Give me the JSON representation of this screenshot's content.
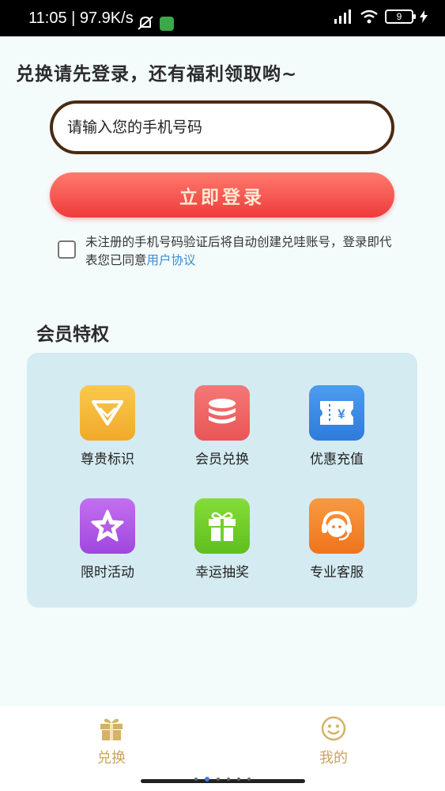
{
  "status_bar": {
    "time": "11:05 | 97.9K/s",
    "battery": "9"
  },
  "headline": "兑换请先登录，还有福利领取哟~",
  "login": {
    "phone_placeholder": "请输入您的手机号码",
    "button_label": "立即登录"
  },
  "agreement": {
    "text": "未注册的手机号码验证后将自动创建兑哇账号，登录即代表您已同意",
    "link": "用户协议"
  },
  "privileges": {
    "title": "会员特权",
    "items": [
      {
        "label": "尊贵标识",
        "icon": "diamond-icon",
        "color": "#f5b83a"
      },
      {
        "label": "会员兑换",
        "icon": "coins-stack-icon",
        "color": "#f06a6a"
      },
      {
        "label": "优惠充值",
        "icon": "yen-coupon-icon",
        "color": "#3d8be6"
      },
      {
        "label": "限时活动",
        "icon": "star-icon",
        "color": "#b25ee8"
      },
      {
        "label": "幸运抽奖",
        "icon": "gift-icon",
        "color": "#72cf2a"
      },
      {
        "label": "专业客服",
        "icon": "customer-service-icon",
        "color": "#f5872e"
      }
    ]
  },
  "tab_bar": {
    "tabs": [
      {
        "label": "兑换",
        "icon": "gift-box-icon"
      },
      {
        "label": "我的",
        "icon": "smiley-icon"
      }
    ],
    "accent": "#caa55d"
  }
}
